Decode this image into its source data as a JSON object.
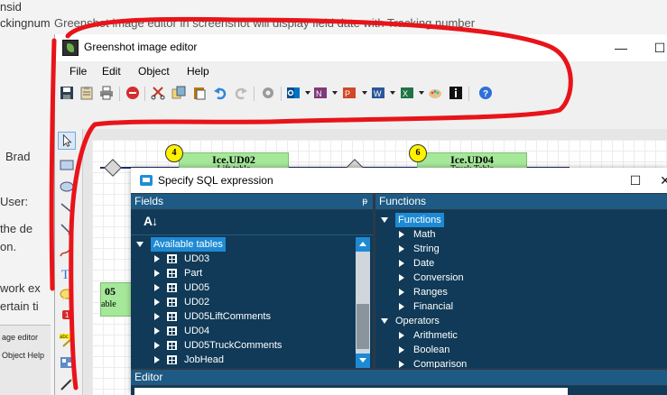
{
  "background": {
    "lines": [
      "nsid",
      "ckingnum",
      "Brad",
      "User:",
      "the de",
      "on.",
      "work ex",
      "ertain ti"
    ],
    "top_text": "Greenshot image editor in screenshot will display field date with Tracking number",
    "mini": {
      "title": "age editor",
      "menu": "Object    Help"
    }
  },
  "window": {
    "title": "Greenshot image editor",
    "minimize": "—",
    "maximize": "☐"
  },
  "menubar": [
    "File",
    "Edit",
    "Object",
    "Help"
  ],
  "toolbar_icons": [
    "save-icon",
    "clipboard-icon",
    "print-icon",
    "stop-icon",
    "cut-icon",
    "copy-icon",
    "paste-icon",
    "undo-icon",
    "redo-icon",
    "settings-icon",
    "outlook-icon",
    "onenote-icon",
    "powerpoint-icon",
    "word-icon",
    "excel-icon",
    "paint-icon",
    "info-icon",
    "help-icon"
  ],
  "colors": {
    "dialog_bg": "#103a57",
    "header_bg": "#1e5a83",
    "highlight": "#1e8ad4",
    "annotation": "#e8141a",
    "node_green": "#a6e89a",
    "badge_yellow": "#fff200"
  },
  "canvas": {
    "nodes": [
      {
        "badge": "4",
        "name": "Ice.UD02",
        "sub": "Lift table"
      },
      {
        "badge": "6",
        "name": "Ice.UD04",
        "sub": "Truck Table"
      }
    ],
    "partial": {
      "name": "05",
      "sub": "able"
    }
  },
  "dialog": {
    "title": "Specify SQL expression",
    "maximize": "☐",
    "close": "✕",
    "fields_header": "Fields",
    "pin": "ᵽ",
    "functions_header": "Functions",
    "sort_label": "A↓",
    "fields_root": "Available tables",
    "fields": [
      "UD03",
      "Part",
      "UD05",
      "UD02",
      "UD05LiftComments",
      "UD04",
      "UD05TruckComments",
      "JobHead"
    ],
    "functions_root": "Functions",
    "functions": [
      "Math",
      "String",
      "Date",
      "Conversion",
      "Ranges",
      "Financial"
    ],
    "operators_root": "Operators",
    "operators": [
      "Arithmetic",
      "Boolean",
      "Comparison"
    ],
    "editor_header": "Editor"
  }
}
